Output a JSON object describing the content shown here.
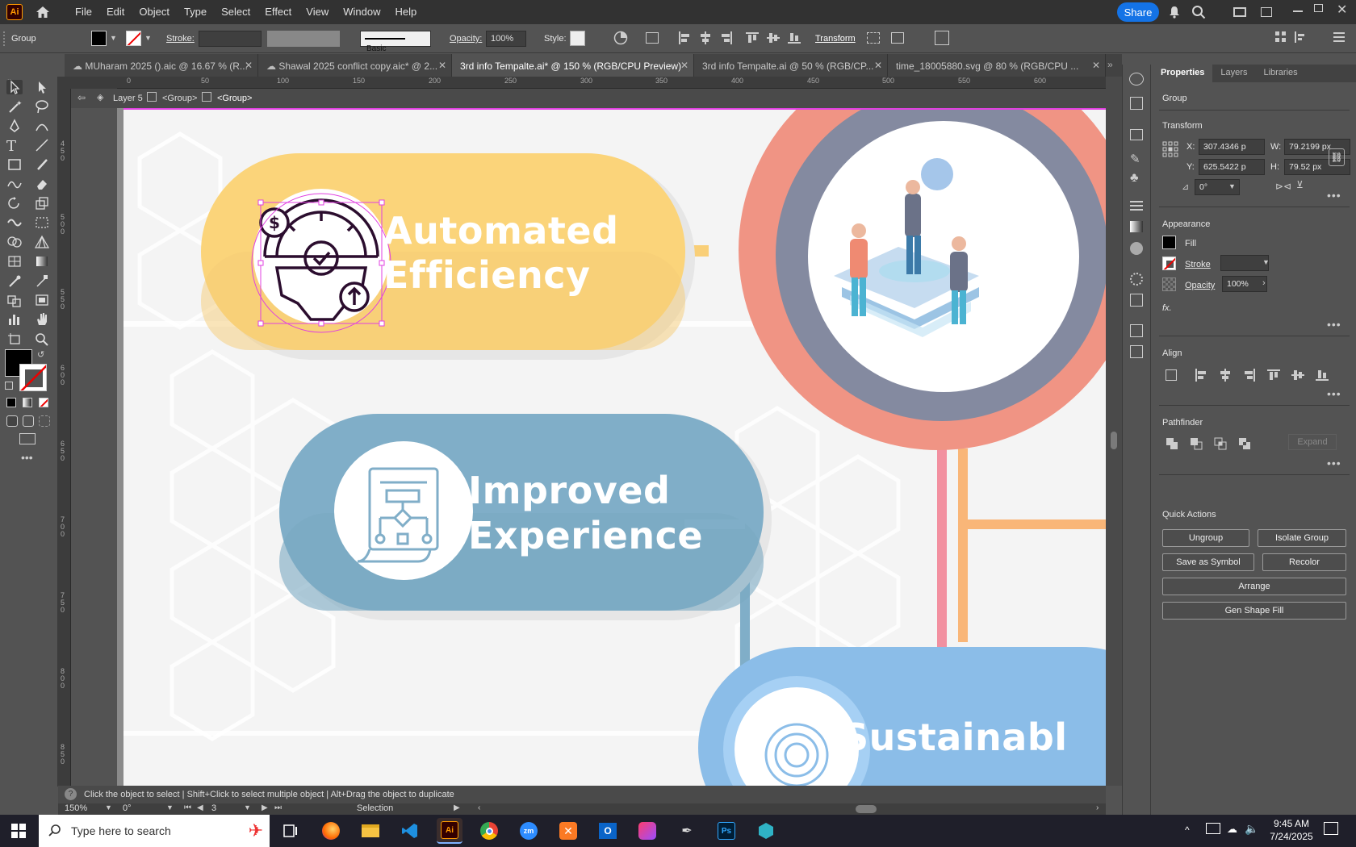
{
  "app": {
    "logo": "Ai",
    "menu": [
      "File",
      "Edit",
      "Object",
      "Type",
      "Select",
      "Effect",
      "View",
      "Window",
      "Help"
    ],
    "share_label": "Share"
  },
  "control": {
    "selection": "Group",
    "stroke_label": "Stroke:",
    "stroke_profile": "Basic",
    "opacity_label": "Opacity:",
    "opacity_value": "100%",
    "style_label": "Style:",
    "transform_label": "Transform"
  },
  "tabs": [
    {
      "label": "MUharam 2025 ().aic @ 16.67 % (R...",
      "active": false
    },
    {
      "label": "Shawal 2025 conflict copy.aic* @ 2...",
      "active": false
    },
    {
      "label": "3rd info Tempalte.ai* @ 150 % (RGB/CPU Preview)",
      "active": true
    },
    {
      "label": "3rd info Tempalte.ai @ 50 % (RGB/CP...",
      "active": false
    },
    {
      "label": "time_18005880.svg @ 80 % (RGB/CPU ...",
      "active": false
    }
  ],
  "ruler": {
    "h_ticks": [
      "0",
      "50",
      "100",
      "150",
      "200",
      "250",
      "300",
      "350",
      "400",
      "450",
      "500",
      "550",
      "600"
    ],
    "v_ticks": [
      "450",
      "500",
      "550",
      "600",
      "650",
      "700",
      "750",
      "800",
      "850"
    ]
  },
  "breadcrumb": {
    "layer": "Layer 5",
    "group1": "<Group>",
    "group2": "<Group>"
  },
  "artwork": {
    "card1_line1": "Automated",
    "card1_line2": "Efficiency",
    "card2_line1": "Improved",
    "card2_line2": "Experience",
    "card3_line1": "Sustainabl",
    "dollar_glyph": "$",
    "colors": {
      "yellow": "#fbd47a",
      "blue": "#80aec8",
      "lightblue": "#8bbde8",
      "coral": "#f09484",
      "slate": "#848aa0",
      "pinkline": "#f290a0",
      "orangeline": "#f9b678"
    }
  },
  "status": {
    "hint": "Click the object to select  |  Shift+Click to select multiple object  |  Alt+Drag the object to duplicate",
    "zoom": "150%",
    "angle": "0°",
    "page": "3",
    "mode": "Selection"
  },
  "panel": {
    "tabs": [
      "Properties",
      "Layers",
      "Libraries"
    ],
    "selection": "Group",
    "transform_title": "Transform",
    "x_label": "X:",
    "x_value": "307.4346 p",
    "y_label": "Y:",
    "y_value": "625.5422 p",
    "w_label": "W:",
    "w_value": "79.2199 px",
    "h_label": "H:",
    "h_value": "79.52 px",
    "rotate_value": "0°",
    "appearance_title": "Appearance",
    "fill_label": "Fill",
    "stroke_label": "Stroke",
    "opacity_label": "Opacity",
    "opacity_value": "100%",
    "fx_label": "fx.",
    "align_title": "Align",
    "pathfinder_title": "Pathfinder",
    "expand_label": "Expand",
    "quick_title": "Quick Actions",
    "btn_ungroup": "Ungroup",
    "btn_isolate": "Isolate Group",
    "btn_symbol": "Save as Symbol",
    "btn_recolor": "Recolor",
    "btn_arrange": "Arrange",
    "btn_genfill": "Gen Shape Fill"
  },
  "taskbar": {
    "search_placeholder": "Type here to search",
    "time": "9:45 AM",
    "date": "7/24/2025",
    "apps": [
      "Ps"
    ]
  }
}
